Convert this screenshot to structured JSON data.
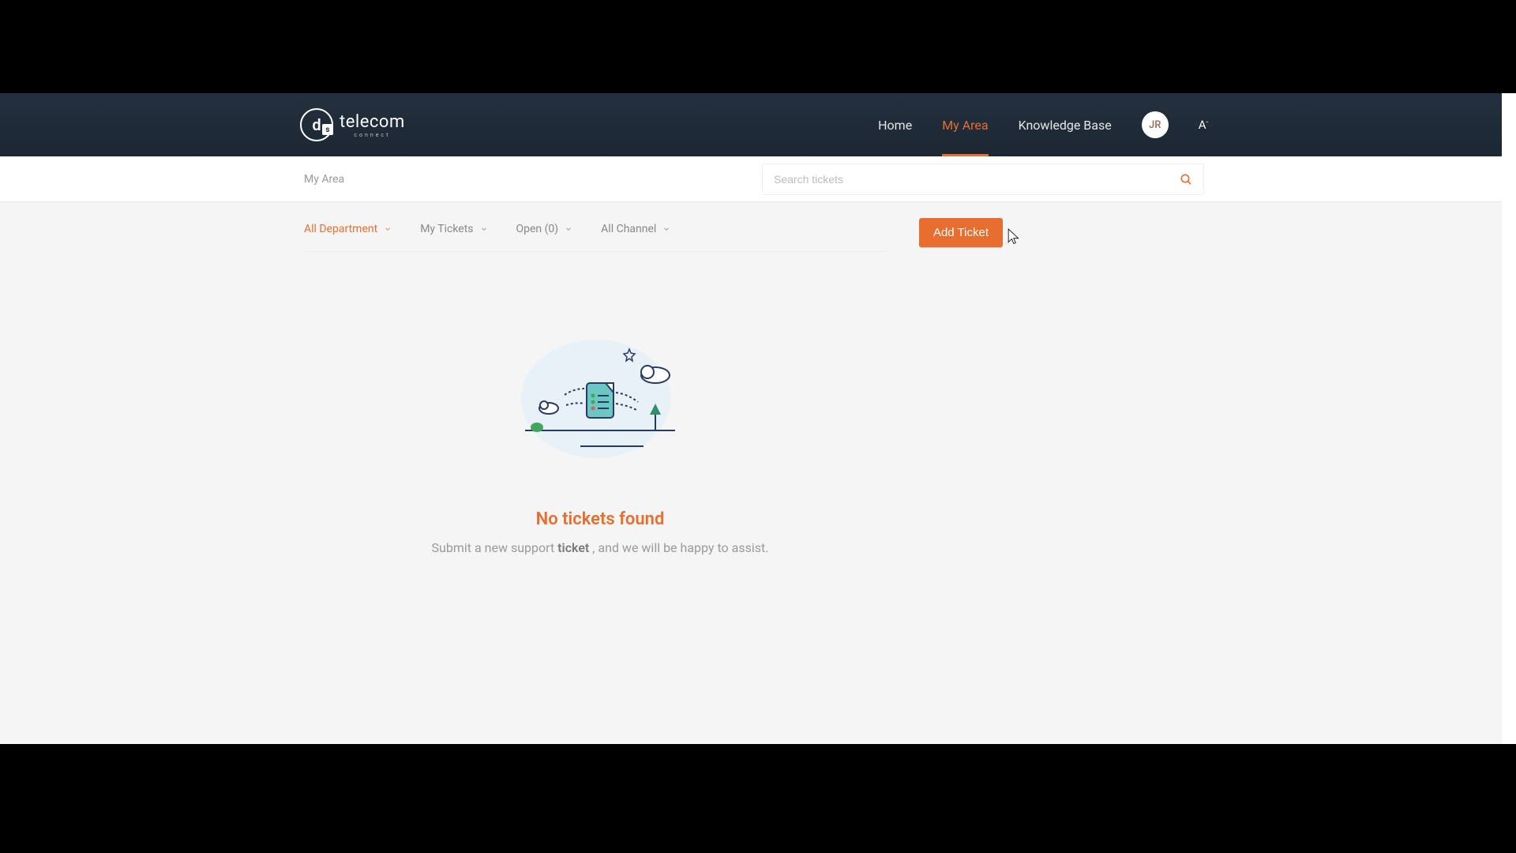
{
  "brand": {
    "name": "telecom",
    "sub": "connect",
    "initial_d": "d",
    "initial_s": "s"
  },
  "nav": {
    "home": "Home",
    "my_area": "My Area",
    "knowledge_base": "Knowledge Base"
  },
  "user": {
    "initials": "JR",
    "text_size_glyph": "A"
  },
  "breadcrumb": "My Area",
  "search": {
    "placeholder": "Search tickets"
  },
  "filters": {
    "department": "All Department",
    "scope": "My Tickets",
    "status": "Open (0)",
    "channel": "All Channel"
  },
  "actions": {
    "add_ticket": "Add Ticket"
  },
  "empty": {
    "title": "No tickets found",
    "sub_prefix": "Submit a new support ",
    "sub_link": "ticket",
    "sub_suffix": " , and we will be happy to assist."
  },
  "colors": {
    "accent": "#e76e2e",
    "header_bg": "#1c2733"
  }
}
